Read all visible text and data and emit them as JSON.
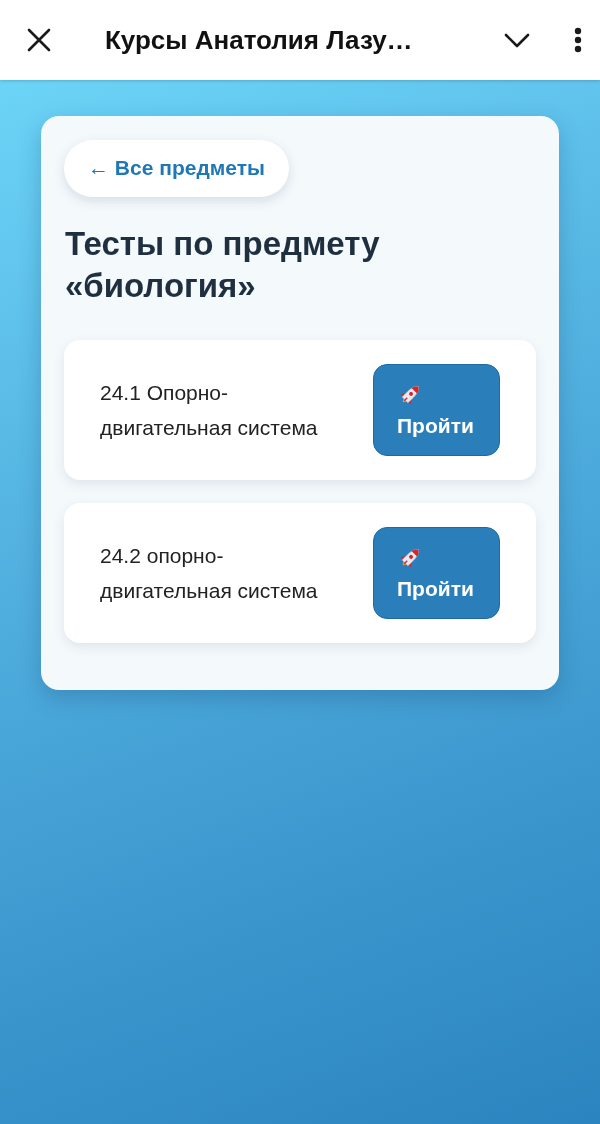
{
  "header": {
    "title": "Курсы Анатолия Лазу…"
  },
  "back_link": {
    "label": "← Все предметы"
  },
  "heading": "Тесты по предмету «биология»",
  "tests": [
    {
      "title": "24.1 Опорно-двигательная система",
      "button": "Пройти"
    },
    {
      "title": "24.2 опорно-двигательная система",
      "button": "Пройти"
    }
  ]
}
